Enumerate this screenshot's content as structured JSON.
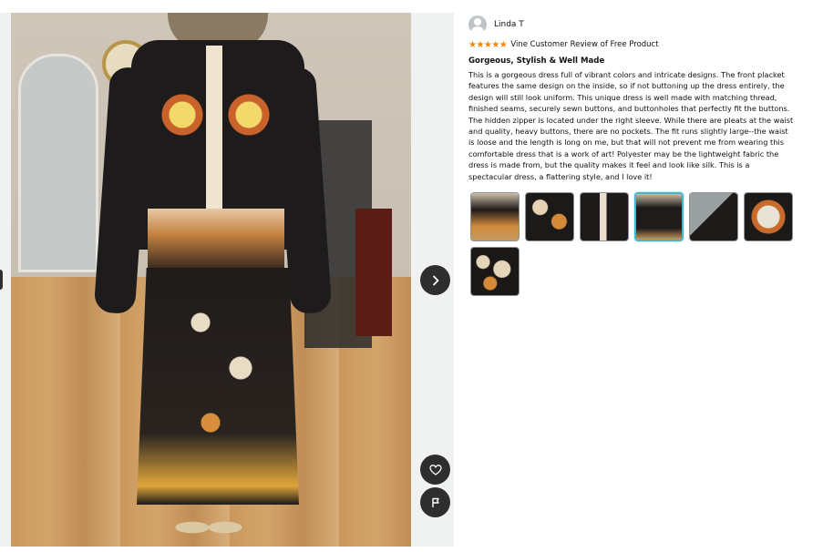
{
  "review": {
    "reviewer_name": "Linda T",
    "stars": "★★★★★",
    "rating_out_of_5": 5,
    "vine_label": "Vine Customer Review of Free Product",
    "title": "Gorgeous, Stylish & Well Made",
    "body": "This is a gorgeous dress full of vibrant colors and intricate designs. The front placket features the same design on the inside, so if not buttoning up the dress entirely, the design will still look uniform. This unique dress is well made with matching thread, finished seams, securely sewn buttons, and buttonholes that perfectly fit the buttons. The hidden zipper is located under the right sleeve. While there are pleats at the waist and quality, heavy buttons, there are no pockets. The fit runs slightly large--the waist is loose and the length is long on me, but that will not prevent me from wearing this comfortable dress that is a work of art! Polyester may be the lightweight fabric the dress is made from, but the quality makes it feel and look like silk. This is a spectacular dress, a flattering style, and I love it!"
  },
  "media": {
    "next_icon": "chevron-right-icon",
    "like_icon": "heart-icon",
    "report_icon": "flag-icon",
    "selected_thumbnail": 4
  },
  "thumbnails": [
    {
      "name": "thumbnail-1",
      "bg": "linear-gradient(180deg,#cdbfa8 0%,#1e1b1a 35%,#cf8a3c 70%,#c69a62 100%)"
    },
    {
      "name": "thumbnail-2",
      "bg": "radial-gradient(circle at 30% 30%,#e6d3b3 0 8px,transparent 9px),radial-gradient(circle at 70% 60%,#d58a3a 0 8px,transparent 9px),#1c1a19"
    },
    {
      "name": "thumbnail-3",
      "bg": "linear-gradient(90deg,#1d1b1a 0 40%,#e9dfcc 40% 55%,#1d1b1a 55% 100%)"
    },
    {
      "name": "thumbnail-4",
      "bg": "linear-gradient(180deg,#c9b99f 0%,#1e1b1a 30%,#1e1b1a 75%,#c7995f 100%)"
    },
    {
      "name": "thumbnail-5",
      "bg": "linear-gradient(135deg,#9aa0a0 0 45%,#1d1b1a 45% 100%)"
    },
    {
      "name": "thumbnail-6",
      "bg": "radial-gradient(circle at 50% 50%,#e9e3d6 0 12px,#c96a2d 13px 18px,#1c1a19 19px)"
    },
    {
      "name": "thumbnail-7",
      "bg": "radial-gradient(circle at 25% 30%,#e5d6ba 0 7px,transparent 8px),radial-gradient(circle at 65% 45%,#e5d6ba 0 9px,transparent 10px),radial-gradient(circle at 40% 75%,#d7893a 0 7px,transparent 8px),#1b1918"
    }
  ]
}
